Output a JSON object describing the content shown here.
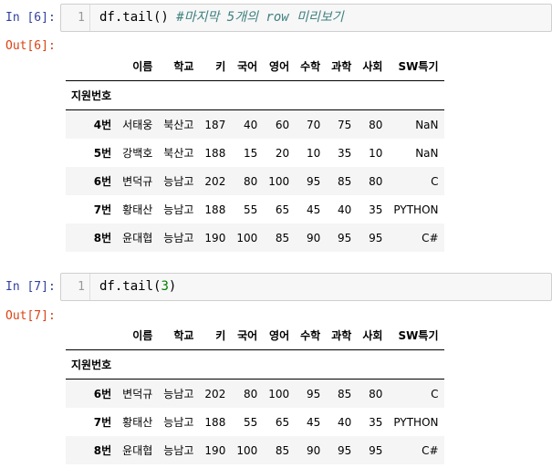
{
  "cells": [
    {
      "in_prompt": "In [6]:",
      "line_number": "1",
      "code": "df.tail()",
      "comment": "#마지막 5개의 row 미리보기",
      "out_prompt": "Out[6]:",
      "table": {
        "columns": [
          "이름",
          "학교",
          "키",
          "국어",
          "영어",
          "수학",
          "과학",
          "사회",
          "SW특기"
        ],
        "index_name": "지원번호",
        "rows": [
          {
            "index": "4번",
            "values": [
              "서태웅",
              "북산고",
              "187",
              "40",
              "60",
              "70",
              "75",
              "80",
              "NaN"
            ]
          },
          {
            "index": "5번",
            "values": [
              "강백호",
              "북산고",
              "188",
              "15",
              "20",
              "10",
              "35",
              "10",
              "NaN"
            ]
          },
          {
            "index": "6번",
            "values": [
              "변덕규",
              "능남고",
              "202",
              "80",
              "100",
              "95",
              "85",
              "80",
              "C"
            ]
          },
          {
            "index": "7번",
            "values": [
              "황태산",
              "능남고",
              "188",
              "55",
              "65",
              "45",
              "40",
              "35",
              "PYTHON"
            ]
          },
          {
            "index": "8번",
            "values": [
              "윤대협",
              "능남고",
              "190",
              "100",
              "85",
              "90",
              "95",
              "95",
              "C#"
            ]
          }
        ]
      }
    },
    {
      "in_prompt": "In [7]:",
      "line_number": "1",
      "code": "df.tail(",
      "code_num": "3",
      "code_end": ")",
      "out_prompt": "Out[7]:",
      "table": {
        "columns": [
          "이름",
          "학교",
          "키",
          "국어",
          "영어",
          "수학",
          "과학",
          "사회",
          "SW특기"
        ],
        "index_name": "지원번호",
        "rows": [
          {
            "index": "6번",
            "values": [
              "변덕규",
              "능남고",
              "202",
              "80",
              "100",
              "95",
              "85",
              "80",
              "C"
            ]
          },
          {
            "index": "7번",
            "values": [
              "황태산",
              "능남고",
              "188",
              "55",
              "65",
              "45",
              "40",
              "35",
              "PYTHON"
            ]
          },
          {
            "index": "8번",
            "values": [
              "윤대협",
              "능남고",
              "190",
              "100",
              "85",
              "90",
              "95",
              "95",
              "C#"
            ]
          }
        ]
      }
    }
  ]
}
